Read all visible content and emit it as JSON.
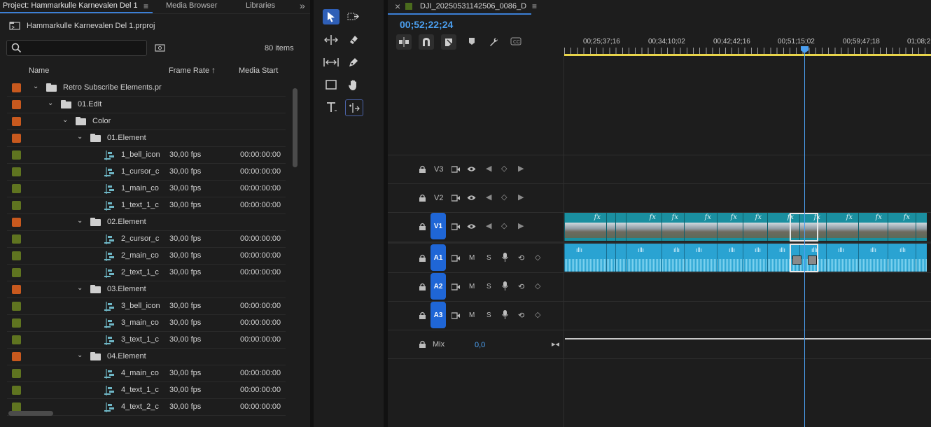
{
  "project": {
    "tabs": [
      {
        "label": "Project: Hammarkulle Karnevalen Del 1"
      },
      {
        "label": "Media Browser"
      },
      {
        "label": "Libraries"
      }
    ],
    "more_symbol": "»",
    "file_name": "Hammarkulle Karnevalen Del 1.prproj",
    "search_placeholder": "",
    "items_count": "80 items",
    "columns": {
      "name": "Name",
      "frame_rate": "Frame Rate",
      "media_start": "Media Start"
    },
    "rows": [
      {
        "type": "folder",
        "depth": 0,
        "name": "Retro Subscribe Elements.pr",
        "fps": "",
        "start": "",
        "color": "#c8591e"
      },
      {
        "type": "folder",
        "depth": 1,
        "name": "01.Edit",
        "fps": "",
        "start": "",
        "color": "#c8591e"
      },
      {
        "type": "folder",
        "depth": 2,
        "name": "Color",
        "fps": "",
        "start": "",
        "color": "#c8591e"
      },
      {
        "type": "folder",
        "depth": 3,
        "name": "01.Element",
        "fps": "",
        "start": "",
        "color": "#c8591e"
      },
      {
        "type": "seq",
        "depth": 4,
        "name": "1_bell_icon",
        "fps": "30,00 fps",
        "start": "00:00:00:00",
        "color": "#5f7420"
      },
      {
        "type": "seq",
        "depth": 4,
        "name": "1_cursor_c",
        "fps": "30,00 fps",
        "start": "00:00:00:00",
        "color": "#5f7420"
      },
      {
        "type": "seq",
        "depth": 4,
        "name": "1_main_co",
        "fps": "30,00 fps",
        "start": "00:00:00:00",
        "color": "#5f7420"
      },
      {
        "type": "seq",
        "depth": 4,
        "name": "1_text_1_c",
        "fps": "30,00 fps",
        "start": "00:00:00:00",
        "color": "#5f7420"
      },
      {
        "type": "folder",
        "depth": 3,
        "name": "02.Element",
        "fps": "",
        "start": "",
        "color": "#c8591e"
      },
      {
        "type": "seq",
        "depth": 4,
        "name": "2_cursor_c",
        "fps": "30,00 fps",
        "start": "00:00:00:00",
        "color": "#5f7420"
      },
      {
        "type": "seq",
        "depth": 4,
        "name": "2_main_co",
        "fps": "30,00 fps",
        "start": "00:00:00:00",
        "color": "#5f7420"
      },
      {
        "type": "seq",
        "depth": 4,
        "name": "2_text_1_c",
        "fps": "30,00 fps",
        "start": "00:00:00:00",
        "color": "#5f7420"
      },
      {
        "type": "folder",
        "depth": 3,
        "name": "03.Element",
        "fps": "",
        "start": "",
        "color": "#c8591e"
      },
      {
        "type": "seq",
        "depth": 4,
        "name": "3_bell_icon",
        "fps": "30,00 fps",
        "start": "00:00:00:00",
        "color": "#5f7420"
      },
      {
        "type": "seq",
        "depth": 4,
        "name": "3_main_co",
        "fps": "30,00 fps",
        "start": "00:00:00:00",
        "color": "#5f7420"
      },
      {
        "type": "seq",
        "depth": 4,
        "name": "3_text_1_c",
        "fps": "30,00 fps",
        "start": "00:00:00:00",
        "color": "#5f7420"
      },
      {
        "type": "folder",
        "depth": 3,
        "name": "04.Element",
        "fps": "",
        "start": "",
        "color": "#c8591e"
      },
      {
        "type": "seq",
        "depth": 4,
        "name": "4_main_co",
        "fps": "30,00 fps",
        "start": "00:00:00:00",
        "color": "#5f7420"
      },
      {
        "type": "seq",
        "depth": 4,
        "name": "4_text_1_c",
        "fps": "30,00 fps",
        "start": "00:00:00:00",
        "color": "#5f7420"
      },
      {
        "type": "seq",
        "depth": 4,
        "name": "4_text_2_c",
        "fps": "30,00 fps",
        "start": "00:00:00:00",
        "color": "#5f7420"
      }
    ]
  },
  "tools": [
    {
      "name": "selection-tool",
      "glyph": "➤",
      "selected": true
    },
    {
      "name": "track-select-forward-tool",
      "glyph": "⇥"
    },
    {
      "name": "ripple-edit-tool",
      "glyph": "⟺"
    },
    {
      "name": "razor-tool",
      "glyph": "◇"
    },
    {
      "name": "slip-tool",
      "glyph": "↔"
    },
    {
      "name": "pen-tool",
      "glyph": "✒"
    },
    {
      "name": "rectangle-tool",
      "glyph": "▭"
    },
    {
      "name": "hand-tool",
      "glyph": "✋"
    },
    {
      "name": "type-tool",
      "glyph": "T"
    },
    {
      "name": "generative-extend-tool",
      "glyph": "⌖"
    }
  ],
  "timeline": {
    "close_symbol": "×",
    "sequence_name": "DJI_20250531142506_0086_D",
    "timecode": "00;52;22;24",
    "ruler_labels": [
      "00;25;37;16",
      "00;34;10;02",
      "00;42;42;16",
      "00;51;15;02",
      "00;59;47;18",
      "01;08;2"
    ],
    "tracks": {
      "v3": "V3",
      "v2": "V2",
      "v1": "V1",
      "a1": "A1",
      "a2": "A2",
      "a3": "A3"
    },
    "mute_label": "M",
    "solo_label": "S",
    "mix_label": "Mix",
    "mix_value": "0,0",
    "fx_label": "fx",
    "colors": {
      "accent": "#4b9ff0",
      "video_clip": "#1a8fa0",
      "audio_clip": "#2aa3d2",
      "track_badge": "#1f66d6",
      "work_area": "#e8d44a"
    }
  }
}
